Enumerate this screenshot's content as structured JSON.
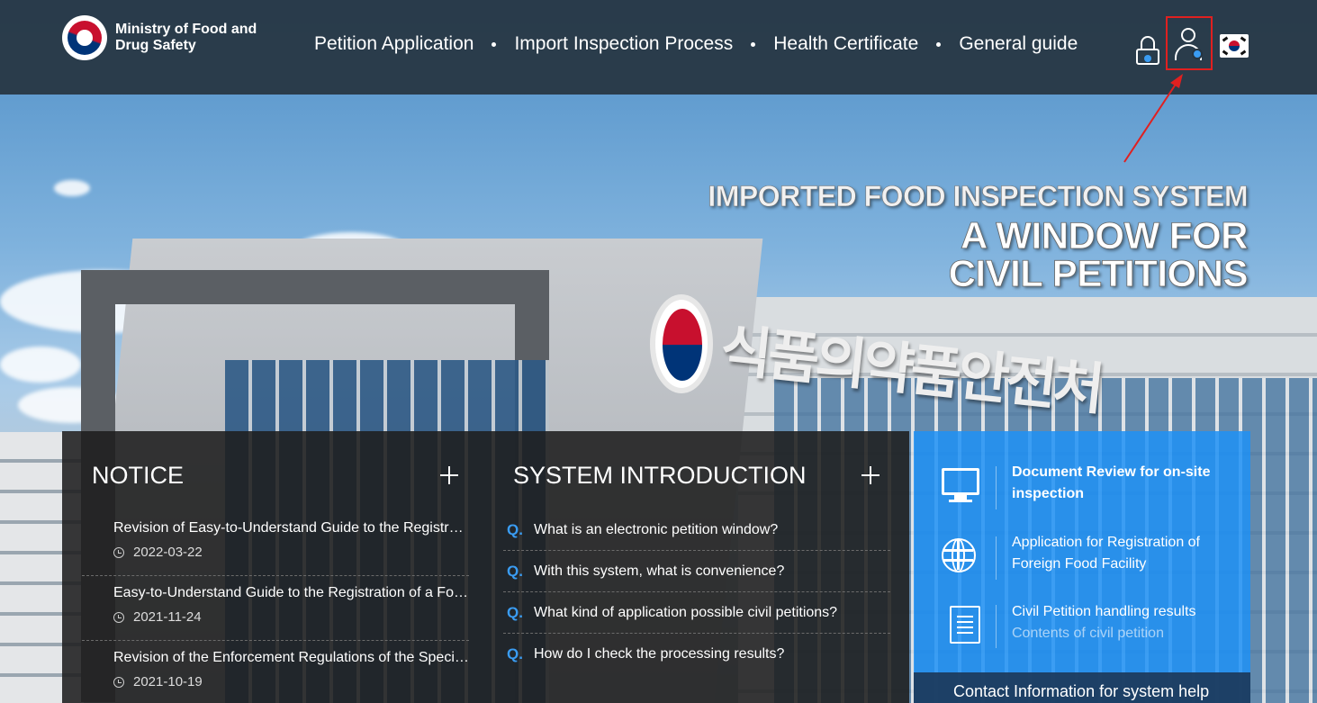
{
  "header": {
    "logo_line1": "Ministry of Food and",
    "logo_line2": "Drug Safety",
    "nav": [
      {
        "label": "Petition Application"
      },
      {
        "label": "Import Inspection Process"
      },
      {
        "label": "Health Certificate"
      },
      {
        "label": "General guide"
      }
    ],
    "icons": [
      "lock-icon",
      "user-icon",
      "korean-flag-icon"
    ]
  },
  "hero": {
    "subtitle": "IMPORTED FOOD INSPECTION SYSTEM",
    "title_line1": "A WINDOW FOR",
    "title_line2": "CIVIL PETITIONS",
    "building_sign": "식품의약품안전처"
  },
  "notice": {
    "title": "NOTICE",
    "items": [
      {
        "title": "Revision of Easy-to-Understand Guide to the Registration of Foreign Food Facility",
        "date": "2022-03-22"
      },
      {
        "title": "Easy-to-Understand Guide to the Registration of a Foreign Food Facility",
        "date": "2021-11-24"
      },
      {
        "title": "Revision of the Enforcement Regulations of the Special Act on Imported Food Safety",
        "date": "2021-10-19"
      }
    ]
  },
  "system_intro": {
    "title": "SYSTEM INTRODUCTION",
    "q_label": "Q.",
    "items": [
      {
        "question": "What is an electronic petition window?"
      },
      {
        "question": "With this system, what is convenience?"
      },
      {
        "question": "What kind of application possible civil petitions?"
      },
      {
        "question": "How do I check the processing results?"
      }
    ]
  },
  "services": {
    "items": [
      {
        "line1": "Document Review for on-site",
        "line2": "inspection",
        "icon": "monitor-icon"
      },
      {
        "line1": "Application for Registration of",
        "line2": "Foreign Food Facility",
        "icon": "globe-icon"
      },
      {
        "line1": "Civil Petition handling results",
        "line2": "Contents of civil petition",
        "icon": "document-icon"
      }
    ],
    "contact": "Contact Information for system help"
  },
  "colors": {
    "header_bg": "#263440",
    "accent_blue": "#1e90f5",
    "highlight_red": "#e02020"
  }
}
